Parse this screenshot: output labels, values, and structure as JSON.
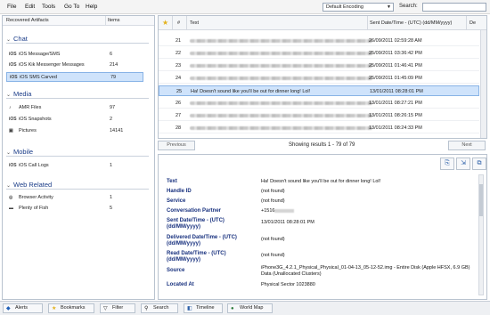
{
  "menu": [
    "File",
    "Edit",
    "Tools",
    "Go To",
    "Help"
  ],
  "toolbar": {
    "encoding": "Default Encoding",
    "search_label": "Search:",
    "search_value": ""
  },
  "artifacts_header": {
    "name": "Recovered Artifacts",
    "count": "Items"
  },
  "categories": [
    {
      "name": "Chat",
      "items": [
        {
          "name": "iOS Message/SMS",
          "count": "6",
          "icon": "ios-icon"
        },
        {
          "name": "iOS Kik Messenger Messages",
          "count": "214",
          "icon": "ios-icon"
        },
        {
          "name": "iOS SMS Carved",
          "count": "79",
          "icon": "ios-icon"
        }
      ]
    },
    {
      "name": "Media",
      "items": [
        {
          "name": "AMR Files",
          "count": "97",
          "icon": "audio-file-icon"
        },
        {
          "name": "iOS Snapshots",
          "count": "2",
          "icon": "ios-icon"
        },
        {
          "name": "Pictures",
          "count": "14141",
          "icon": "pictures-icon"
        }
      ]
    },
    {
      "name": "Mobile",
      "items": [
        {
          "name": "iOS Call Logs",
          "count": "1",
          "icon": "ios-icon"
        }
      ]
    },
    {
      "name": "Web Related",
      "items": [
        {
          "name": "Browser Activity",
          "count": "1",
          "icon": "browser-icon"
        },
        {
          "name": "Plenty of Fish",
          "count": "5",
          "icon": "pof-icon"
        }
      ]
    }
  ],
  "grid": {
    "columns": [
      "#",
      "Text",
      "Sent Date/Time - (UTC) (dd/MM/yyyy)",
      "De"
    ],
    "rows": [
      {
        "num": "21",
        "text": "",
        "date": "26/09/2011 02:59:28 AM"
      },
      {
        "num": "22",
        "text": "",
        "date": "25/09/2011 03:36:42 PM"
      },
      {
        "num": "23",
        "text": "",
        "date": "25/09/2011 01:46:41 PM"
      },
      {
        "num": "24",
        "text": "",
        "date": "25/09/2011 01:45:09 PM"
      },
      {
        "num": "25",
        "text": "Ha! Doesn't sound like you'll be out for dinner long! Lol!",
        "date": "13/01/2011 08:28:01 PM"
      },
      {
        "num": "26",
        "text": "",
        "date": "13/01/2011 08:27:21 PM"
      },
      {
        "num": "27",
        "text": "",
        "date": "13/01/2011 08:26:15 PM"
      },
      {
        "num": "28",
        "text": "",
        "date": "13/01/2011 08:24:33 PM"
      }
    ]
  },
  "pager": {
    "previous": "Previous",
    "next": "Next",
    "info": "Showing results 1 - 79 of 79"
  },
  "detail": {
    "fields": [
      {
        "label": "Text",
        "value": "Ha! Doesn't sound like you'll be out for dinner long! Lol!"
      },
      {
        "label": "Handle ID",
        "value": "(not found)"
      },
      {
        "label": "Service",
        "value": "(not found)"
      },
      {
        "label": "Conversation Partner",
        "value": "+1516"
      },
      {
        "label": "Sent Date/Time - (UTC) (dd/MM/yyyy)",
        "value": "13/01/2011 08:28:01 PM"
      },
      {
        "label": "Delivered Date/Time - (UTC) (dd/MM/yyyy)",
        "value": "(not found)"
      },
      {
        "label": "Read Date/Time - (UTC) (dd/MM/yyyy)",
        "value": "(not found)"
      },
      {
        "label": "Source",
        "value": "iPhone3G_4.2.1_Physical_Physical_01-04-13_05-12-52.img - Entire Disk (Apple HFSX, 6.9 GB) Data (Unallocated Clusters)"
      },
      {
        "label": "Located At",
        "value": "Physical Sector 1023880"
      }
    ]
  },
  "bottom": [
    "Alerts",
    "Bookmarks",
    "Filter",
    "Search",
    "Timeline",
    "World Map"
  ]
}
